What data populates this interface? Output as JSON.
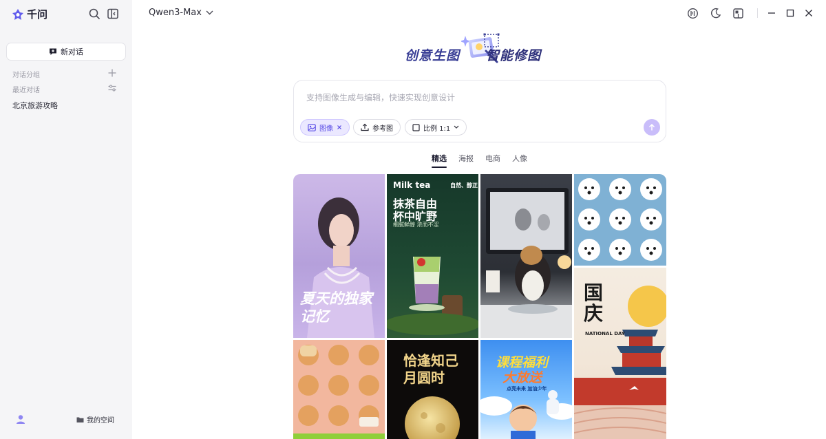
{
  "app": {
    "logo_text": "千问"
  },
  "sidebar": {
    "new_chat_label": "新对话",
    "groups_label": "对话分组",
    "recent_label": "最近对话",
    "history": [
      "北京旅游攻略"
    ],
    "my_space_label": "我的空间"
  },
  "header": {
    "model_name": "Qwen3-Max"
  },
  "banner": {
    "left_text": "创意生图",
    "right_text": "智能修图"
  },
  "prompt": {
    "placeholder": "支持图像生成与编辑，快速实现创意设计",
    "chips": {
      "image": "图像",
      "reference": "参考图",
      "ratio": "比例 1:1"
    }
  },
  "tabs": [
    "精选",
    "海报",
    "电商",
    "人像"
  ],
  "gallery": {
    "poster1_title": "夏天的独家记忆",
    "poster2_brand": "Milk tea",
    "poster2_tag": "自然、醇正",
    "poster2_title1": "抹茶自由",
    "poster2_title2": "杯中旷野",
    "poster2_sub": "细腻鲜醇 浓而不涩",
    "national_title": "国庆",
    "national_sub": "NATIONAL DAY",
    "moon_title": "恰逢知己月圆时",
    "course_title1": "课程福利",
    "course_title2": "大放送",
    "course_sub": "点亮未来 加油少年"
  },
  "colors": {
    "accent": "#5b4ee6",
    "brand": "#615ced"
  }
}
